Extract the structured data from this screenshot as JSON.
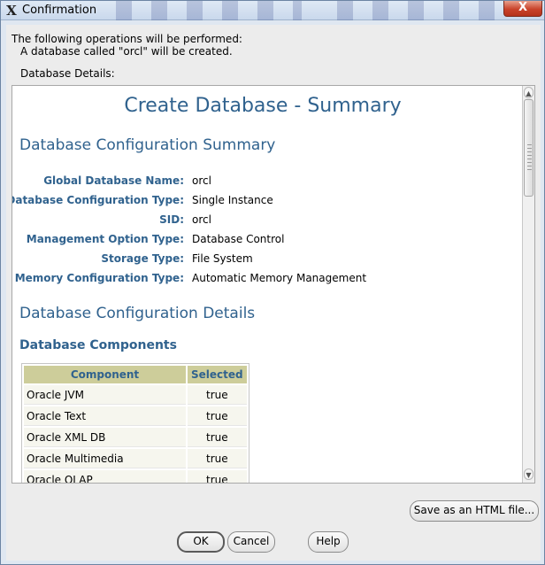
{
  "window": {
    "title": "Confirmation",
    "close_glyph": "X"
  },
  "intro": {
    "line1": "The following operations will be performed:",
    "line2": "A database called \"orcl\" will be created."
  },
  "details_label": "Database Details:",
  "report": {
    "title": "Create Database - Summary",
    "section1": "Database Configuration Summary",
    "fields": [
      {
        "label": "Global Database Name:",
        "value": "orcl"
      },
      {
        "label": "Database Configuration Type:",
        "value": "Single Instance"
      },
      {
        "label": "SID:",
        "value": "orcl"
      },
      {
        "label": "Management Option Type:",
        "value": "Database Control"
      },
      {
        "label": "Storage Type:",
        "value": "File System"
      },
      {
        "label": "Memory Configuration Type:",
        "value": "Automatic Memory Management"
      }
    ],
    "section2": "Database Configuration Details",
    "section3": "Database Components",
    "table": {
      "headers": [
        "Component",
        "Selected"
      ],
      "rows": [
        [
          "Oracle JVM",
          "true"
        ],
        [
          "Oracle Text",
          "true"
        ],
        [
          "Oracle XML DB",
          "true"
        ],
        [
          "Oracle Multimedia",
          "true"
        ],
        [
          "Oracle OLAP",
          "true"
        ]
      ]
    }
  },
  "buttons": {
    "save_html": "Save as an HTML file...",
    "ok": "OK",
    "cancel": "Cancel",
    "help": "Help"
  },
  "icons": {
    "app": "x11-icon",
    "close": "close-icon",
    "scroll_up": "arrow-up-icon",
    "scroll_down": "arrow-down-icon"
  },
  "colors": {
    "heading": "#30628e",
    "table_header": "#cdcd9a",
    "close_button": "#c9432b"
  }
}
